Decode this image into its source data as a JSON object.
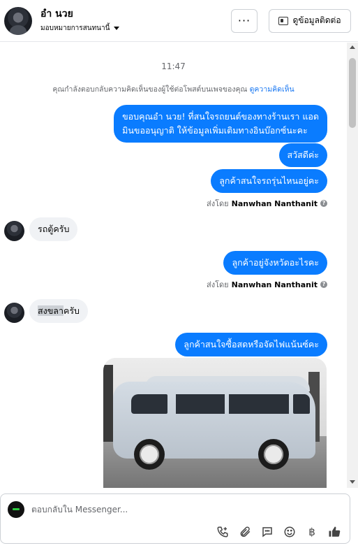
{
  "header": {
    "name": "อำ นวย",
    "assign_label": "มอบหมายการสนทนานี้",
    "more_label": "···",
    "profile_label": "ดูข้อมูลติดต่อ"
  },
  "conversation": {
    "timestamp": "11:47",
    "notice_text": "คุณกำลังตอบกลับความคิดเห็นของผู้ใช้ต่อโพสต์บนเพจของคุณ",
    "notice_link": "ดูความคิดเห็น",
    "messages": [
      {
        "direction": "out",
        "text_line1": "ขอบคุณอำ นวย! ที่สนใจรถยนต์ของทางร้านเรา แอด",
        "text_line2": "มินขออนุญาติ ให้ข้อมูลเพิ่มเติมทางอินบ๊อกซ์นะคะ"
      },
      {
        "direction": "out",
        "text": "สวัสดีค่ะ"
      },
      {
        "direction": "out",
        "text": "ลูกค้าสนใจรถรุ่นไหนอยู่คะ"
      },
      {
        "direction": "sent_by",
        "prefix": "ส่งโดย",
        "author": "Nanwhan Nanthanit"
      },
      {
        "direction": "in",
        "text": "รถตู้ครับ"
      },
      {
        "direction": "out",
        "text": "ลูกค้าอยู่จังหวัดอะไรคะ"
      },
      {
        "direction": "sent_by",
        "prefix": "ส่งโดย",
        "author": "Nanwhan Nanthanit"
      },
      {
        "direction": "in",
        "text_highlight": "สงขลา",
        "text_rest": "ครับ"
      },
      {
        "direction": "out",
        "text": "ลูกค้าสนใจซื้อสดหรือจัดไฟแน้นซ์คะ"
      }
    ]
  },
  "composer": {
    "placeholder": "ตอบกลับใน Messenger...",
    "currency_symbol": "฿"
  },
  "colors": {
    "accent": "#0a7cff",
    "incoming_bubble": "#f0f2f5"
  }
}
